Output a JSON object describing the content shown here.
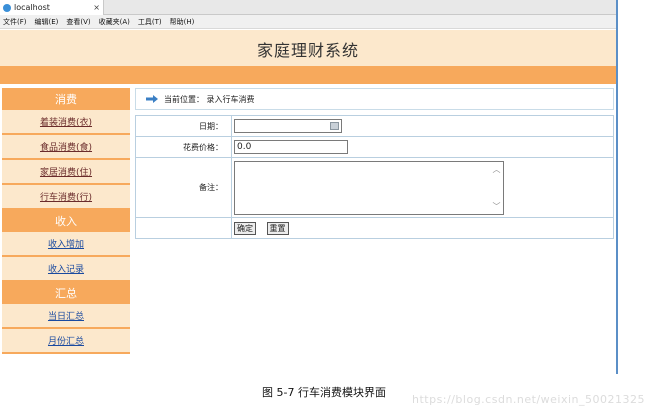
{
  "browser": {
    "tab_title": "localhost",
    "tab_close": "×",
    "menu": [
      "文件(F)",
      "编辑(E)",
      "查看(V)",
      "收藏夹(A)",
      "工具(T)",
      "帮助(H)"
    ]
  },
  "header": {
    "title": "家庭理财系统"
  },
  "sidebar": {
    "sections": [
      {
        "label": "消费",
        "items": [
          "着装消费(衣)",
          "食品消费(食)",
          "家居消费(住)",
          "行车消费(行)"
        ]
      },
      {
        "label": "收入",
        "items": [
          "收入增加",
          "收入记录"
        ]
      },
      {
        "label": "汇总",
        "items": [
          "当日汇总",
          "月份汇总"
        ]
      }
    ]
  },
  "main": {
    "location": "当前位置： 录入行车消费",
    "form": {
      "date_label": "日期：",
      "date_value": "",
      "price_label": "花费价格：",
      "price_value": "0.0",
      "note_label": "备注：",
      "note_value": "",
      "confirm_label": "确定",
      "reset_label": "重置"
    }
  },
  "caption": "图 5-7 行车消费模块界面",
  "watermark": "https://blog.csdn.net/weixin_50021325"
}
